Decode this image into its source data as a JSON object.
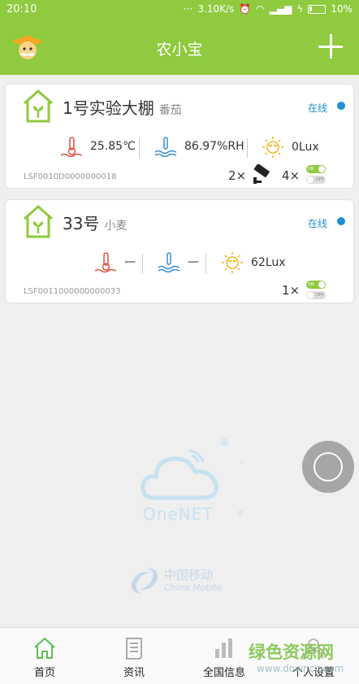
{
  "status": {
    "time": "20:10",
    "network_speed": "3.10K/s",
    "battery": "10%"
  },
  "header": {
    "title": "农小宝",
    "add_icon": "plus-icon",
    "avatar_icon": "farmer-avatar-icon"
  },
  "devices": [
    {
      "name": "1号实验大棚",
      "crop": "番茄",
      "status": "在线",
      "temperature": "25.85℃",
      "humidity": "86.97%RH",
      "light": "0Lux",
      "serial": "LSF0010D0000000018",
      "camera_count": "2×",
      "switch_count": "4×"
    },
    {
      "name": "33号",
      "crop": "小麦",
      "status": "在线",
      "temperature": "—",
      "humidity": "—",
      "light": "62Lux",
      "serial": "LSF0011000000000033",
      "switch_count": "1×"
    }
  ],
  "toggle": {
    "on": "ON",
    "off": "OFF"
  },
  "watermark": {
    "onenet": "OneNET",
    "carrier_cn": "中国移动",
    "carrier_en": "China Mobile"
  },
  "tabs": [
    {
      "label": "首页",
      "icon": "home-icon"
    },
    {
      "label": "资讯",
      "icon": "news-icon"
    },
    {
      "label": "全国信息",
      "icon": "chart-icon"
    },
    {
      "label": "个人设置",
      "icon": "settings-icon"
    }
  ],
  "site_watermark": {
    "name": "绿色资源网",
    "url": "www.downcc.com"
  },
  "colors": {
    "brand": "#8fca3f",
    "online": "#1e90d8",
    "temperature": "#e0533f",
    "humidity": "#3a8fd0",
    "light": "#f2b82a"
  }
}
